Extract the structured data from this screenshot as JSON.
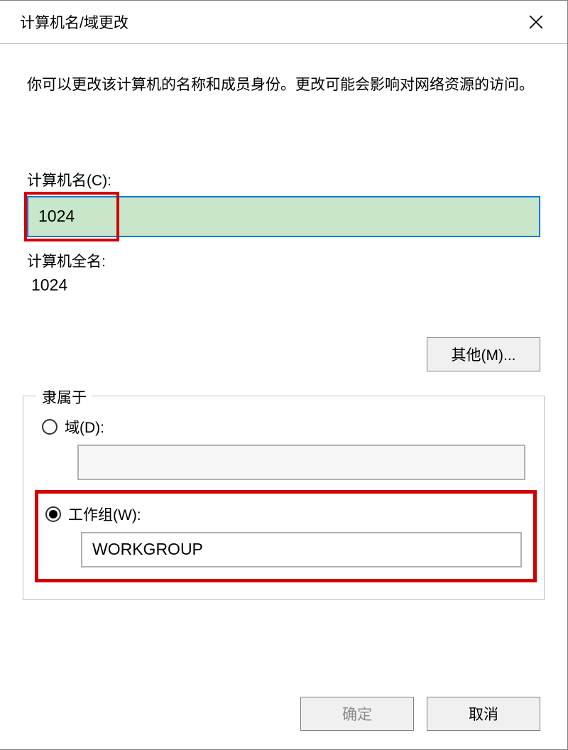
{
  "dialog": {
    "title": "计算机名/域更改",
    "description": "你可以更改该计算机的名称和成员身份。更改可能会影响对网络资源的访问。"
  },
  "computerName": {
    "label": "计算机名(C):",
    "value": "1024",
    "fullNameLabel": "计算机全名:",
    "fullNameValue": "1024"
  },
  "buttons": {
    "more": "其他(M)...",
    "ok": "确定",
    "cancel": "取消"
  },
  "membership": {
    "legend": "隶属于",
    "domainLabel": "域(D):",
    "domainValue": "",
    "domainSelected": false,
    "workgroupLabel": "工作组(W):",
    "workgroupValue": "WORKGROUP",
    "workgroupSelected": true
  }
}
